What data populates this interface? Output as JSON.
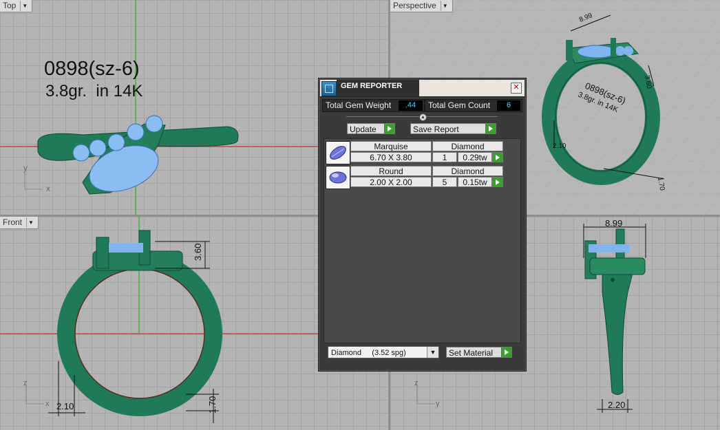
{
  "viewports": {
    "top": {
      "label": "Top"
    },
    "perspective": {
      "label": "Perspective"
    },
    "front": {
      "label": "Front"
    },
    "right": {
      "label": ""
    }
  },
  "annotation": {
    "line1": "0898(sz-6)",
    "line2": "3.8gr.  in 14K"
  },
  "axes": {
    "x": "x",
    "y": "y",
    "z": "z"
  },
  "dimensions": {
    "persp_top": "8.99",
    "persp_side": "3.60",
    "persp_left": "2.10",
    "persp_bottom": "1.70",
    "front_height": "3.60",
    "front_bottom_left": "2.10",
    "front_bottom_right": "1.70",
    "right_top": "8.99",
    "right_bottom": "2.20"
  },
  "panel": {
    "title": "GEM REPORTER",
    "close": "✕",
    "total_weight_label": "Total Gem Weight",
    "total_weight_value": ".44",
    "total_count_label": "Total Gem Count",
    "total_count_value": "6",
    "update_label": "Update",
    "save_label": "Save Report",
    "gems": [
      {
        "shape": "Marquise",
        "material": "Diamond",
        "size": "6.70 X 3.80",
        "count": "1",
        "weight": "0.29tw"
      },
      {
        "shape": "Round",
        "material": "Diamond",
        "size": "2.00 X 2.00",
        "count": "5",
        "weight": "0.15tw"
      }
    ],
    "material_select": "Diamond     (3.52 spg)",
    "set_material_label": "Set Material"
  },
  "colors": {
    "metal": "#1f7a57",
    "gem": "#7fb4ef",
    "grid": "#a3a3a3"
  }
}
